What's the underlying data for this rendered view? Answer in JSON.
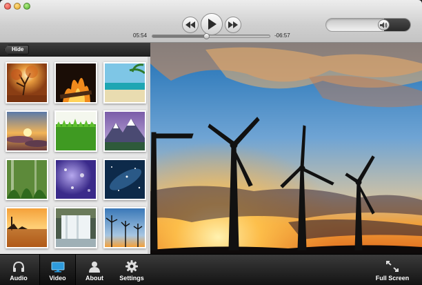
{
  "window": {
    "traffic_lights": [
      "close",
      "minimize",
      "zoom"
    ]
  },
  "transport": {
    "rewind_icon": "rewind-icon",
    "play_icon": "play-icon",
    "forward_icon": "fast-forward-icon",
    "elapsed": "05:54",
    "remaining": "-06:57",
    "progress": 0.46
  },
  "volume": {
    "level": 0.31,
    "icon": "speaker-icon"
  },
  "sidebar": {
    "hide_label": "Hide",
    "thumbnails": [
      "autumn-tree",
      "fireplace",
      "tropical-beach",
      "sunset-clouds",
      "green-grass",
      "snowy-mountains",
      "fern-forest",
      "purple-rain",
      "starry-space",
      "lake-sunset",
      "waterfall",
      "wind-turbines"
    ]
  },
  "bottombar": {
    "audio": {
      "label": "Audio",
      "icon": "headphones-icon"
    },
    "video": {
      "label": "Video",
      "icon": "monitor-icon"
    },
    "about": {
      "label": "About",
      "icon": "person-icon"
    },
    "settings": {
      "label": "Settings",
      "icon": "gear-icon"
    },
    "fullscreen": {
      "label": "Full Screen",
      "icon": "expand-arrows-icon"
    }
  },
  "colors": {
    "active_tab_icon": "#2e9bdc",
    "toolbar": "#1f1f1f",
    "sky_top": "#1d6fb4",
    "sunset": "#f0a03a"
  }
}
